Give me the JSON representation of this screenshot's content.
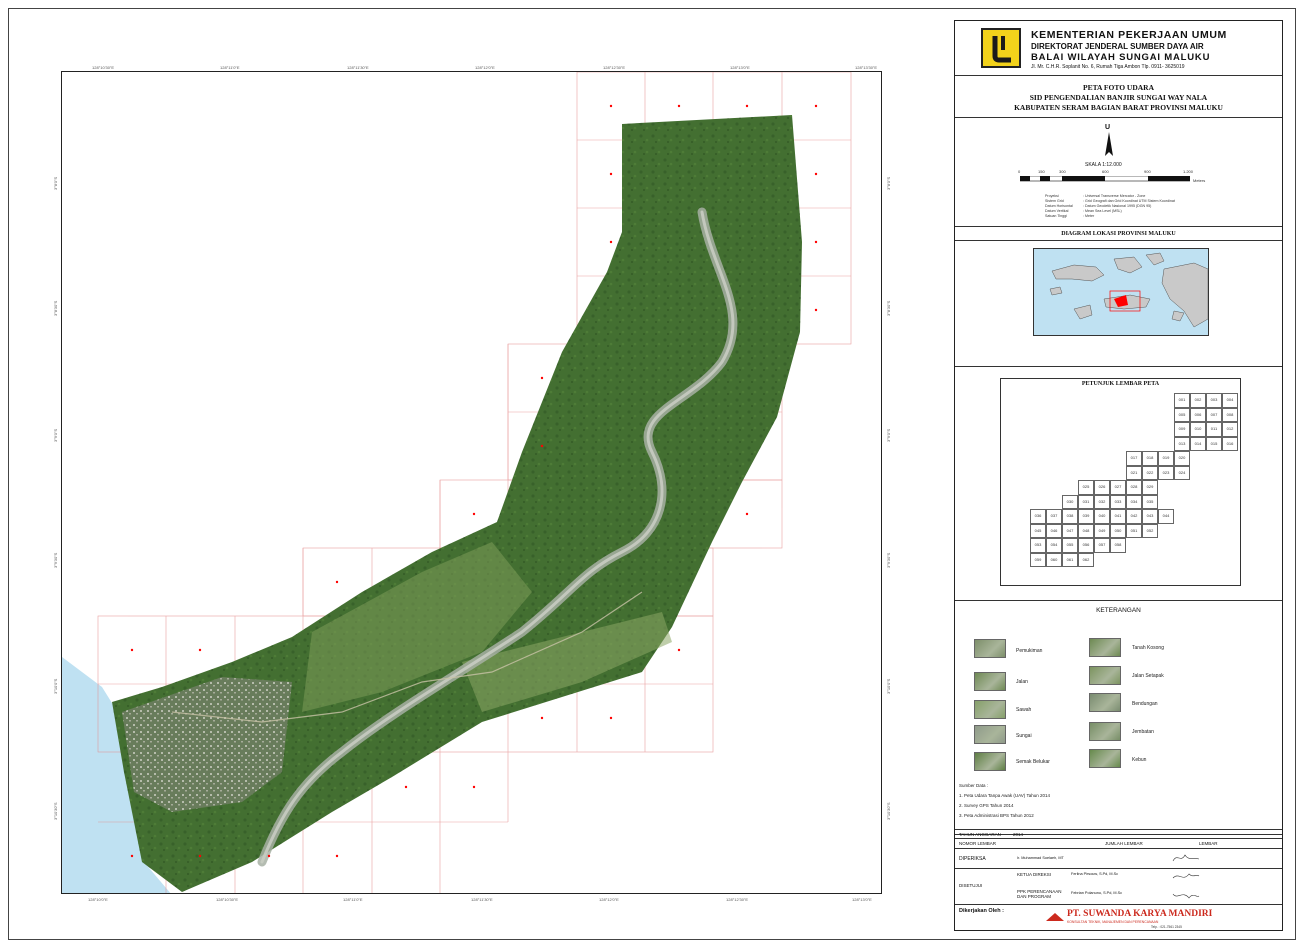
{
  "header": {
    "ministry": "KEMENTERIAN PEKERJAAN UMUM",
    "directorate": "DIREKTORAT JENDERAL SUMBER DAYA AIR",
    "office": "BALAI WILAYAH SUNGAI MALUKU",
    "address": "Jl. Mr. C.H.R. Soplanit No. 6, Rumah Tiga Ambon Tlp. 0911- 3625019"
  },
  "map_title": {
    "line1": "PETA FOTO UDARA",
    "line2": "SID PENGENDALIAN BANJIR SUNGAI WAY NALA",
    "line3": "KABUPATEN SERAM BAGIAN BARAT PROVINSI MALUKU"
  },
  "north": {
    "label": "U"
  },
  "scale": {
    "label": "SKALA   1:12.000",
    "ticks": [
      "0",
      "150",
      "300",
      "600",
      "900",
      "1.200"
    ],
    "unit": "Meters"
  },
  "projection": [
    [
      "Proyeksi",
      ": Universal Transverse Mercator - Zone"
    ],
    [
      "Sistem Grid",
      ": Grid Geografi dan Grid Koordinat UTM Sistem Koordinat"
    ],
    [
      "Datum Horisontal",
      ": Datum Geodetik Nasional 1995 (DGN 95)"
    ],
    [
      "Datum Vertikal",
      ": Mean Sea Level (MSL)"
    ],
    [
      "Satuan Tinggi",
      ": Meter"
    ]
  ],
  "location_diagram": {
    "title": "DIAGRAM LOKASI PROVINSI MALUKU"
  },
  "sheet_index": {
    "title": "PETUNJUK LEMBAR PETA",
    "rows": [
      {
        "start": 9,
        "cells": [
          "001",
          "002",
          "003",
          "004"
        ]
      },
      {
        "start": 9,
        "cells": [
          "005",
          "006",
          "007",
          "008"
        ]
      },
      {
        "start": 9,
        "cells": [
          "009",
          "010",
          "011",
          "012"
        ]
      },
      {
        "start": 9,
        "cells": [
          "013",
          "014",
          "015",
          "016"
        ]
      },
      {
        "start": 6,
        "cells": [
          "017",
          "018",
          "019",
          "020"
        ]
      },
      {
        "start": 6,
        "cells": [
          "021",
          "022",
          "023",
          "024"
        ]
      },
      {
        "start": 3,
        "cells": [
          "025",
          "026",
          "027",
          "028",
          "029"
        ]
      },
      {
        "start": 2,
        "cells": [
          "030",
          "031",
          "032",
          "033",
          "034",
          "035"
        ]
      },
      {
        "start": 0,
        "cells": [
          "036",
          "037",
          "038",
          "039",
          "040",
          "041",
          "042",
          "043",
          "044"
        ]
      },
      {
        "start": 0,
        "cells": [
          "045",
          "046",
          "047",
          "048",
          "049",
          "050",
          "051",
          "052"
        ]
      },
      {
        "start": 0,
        "cells": [
          "053",
          "054",
          "055",
          "056",
          "057",
          "058"
        ]
      },
      {
        "start": 0,
        "cells": [
          "059",
          "060",
          "061",
          "062"
        ]
      }
    ]
  },
  "legend": {
    "title": "KETERANGAN",
    "left": [
      {
        "label": "Pemukiman",
        "color": "#7d8f6a"
      },
      {
        "label": "Jalan",
        "color": "#6f8a55"
      },
      {
        "label": "Sawah",
        "color": "#86a06a"
      },
      {
        "label": "Sungai",
        "color": "#8f9a8a"
      },
      {
        "label": "Semak Belukar",
        "color": "#5f7f45"
      }
    ],
    "right": [
      {
        "label": "Tanah Kosong",
        "color": "#6d8a52"
      },
      {
        "label": "Jalan Setapak",
        "color": "#7c9460"
      },
      {
        "label": "Bendungan",
        "color": "#7a8c70"
      },
      {
        "label": "Jembatan",
        "color": "#778e66"
      },
      {
        "label": "Kebun",
        "color": "#668a4c"
      }
    ]
  },
  "sources": {
    "title": "Sumber Data :",
    "items": [
      "1. Peta Udara Tanpa Awak (UAV) Tahun 2014",
      "2. Survey GPS Tahun 2014",
      "3. Peta Administrasi BPS Tahun 2012"
    ]
  },
  "info_table": {
    "tahun_label": "TAHUN ANGGARAN",
    "tahun_value": "2014",
    "nomor_label": "NOMOR LEMBAR",
    "jumlah_label": "JUMLAH LEMBAR",
    "jumlah_value": "LEMBAR",
    "diperiksa_label": "DIPERIKSA",
    "diperiksa_value": "Ir. Muhammad Soelaeh, MT",
    "disetujui_label": "DISETUJUI",
    "ketua_label": "KETUA DIREKSI",
    "ketua_value": "Ferlina Pirsouw, S.Pd, M.Sc",
    "ppk_label": "PPK PERENCANAAN DAN PROGRAM",
    "ppk_value": "Febrian Polanunu, S.Pd, M.Sc",
    "prepared_label": "Dikerjakan Oleh :",
    "company": "PT. SUWANDA KARYA MANDIRI",
    "company_sub": "KONSULTAN TEKNIK, MANAJEMEN DAN PERENCANAAN",
    "company_tel": "Telp. : 021-7561 2345"
  },
  "axes": {
    "top": [
      "128°10'30\"E",
      "128°11'0\"E",
      "128°11'30\"E",
      "128°12'0\"E",
      "128°12'30\"E",
      "128°13'0\"E",
      "128°13'30\"E"
    ],
    "bottom": [
      "128°10'0\"E",
      "128°10'30\"E",
      "128°11'0\"E",
      "128°11'30\"E",
      "128°12'0\"E",
      "128°12'30\"E",
      "128°13'0\"E"
    ],
    "left": [
      "3°8'0\"S",
      "3°8'30\"S",
      "3°9'0\"S",
      "3°9'30\"S",
      "3°10'0\"S",
      "3°10'30\"S"
    ],
    "right": [
      "3°8'0\"S",
      "3°8'30\"S",
      "3°9'0\"S",
      "3°9'30\"S",
      "3°10'0\"S",
      "3°10'30\"S"
    ]
  },
  "colors": {
    "sea": "#bfe1f2",
    "forest": "#3f6b2f",
    "farmland": "#7b9a58",
    "river": "#9ea89a",
    "grid": "#e58a8a",
    "marker": "#ff0000",
    "logo": "#f2d21b"
  }
}
